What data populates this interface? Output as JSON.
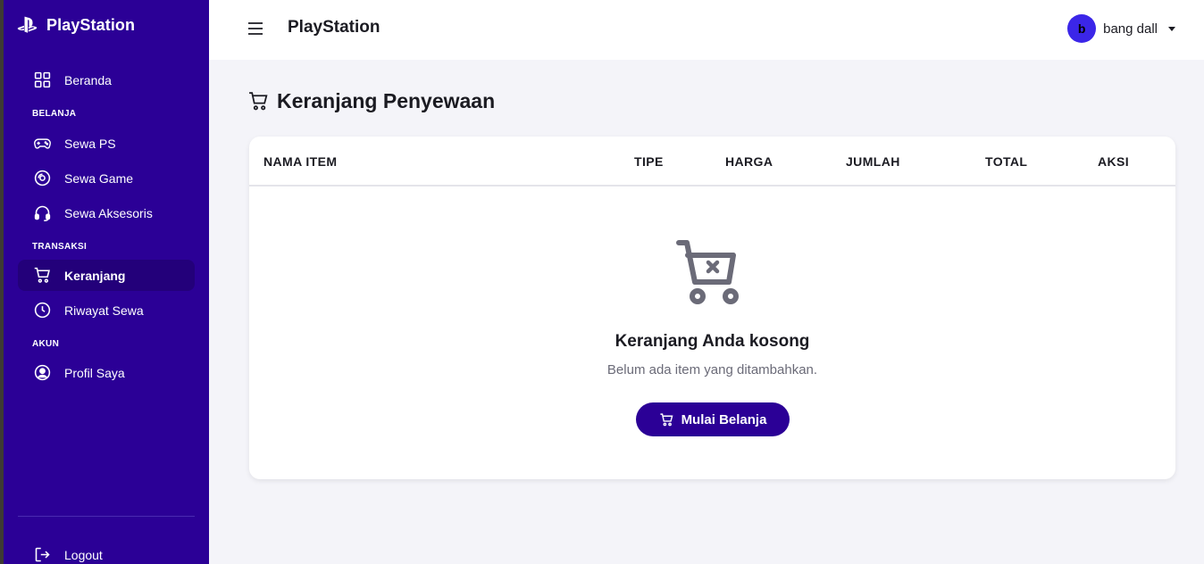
{
  "brand": {
    "name": "PlayStation",
    "icon": "playstation-logo-icon"
  },
  "sidebar": {
    "home": {
      "label": "Beranda",
      "icon": "grid-icon"
    },
    "section_shop": "BELANJA",
    "shop_items": [
      {
        "label": "Sewa PS",
        "icon": "gamepad-icon"
      },
      {
        "label": "Sewa Game",
        "icon": "disc-icon"
      },
      {
        "label": "Sewa Aksesoris",
        "icon": "headset-icon"
      }
    ],
    "section_transactions": "TRANSAKSI",
    "transaction_items": [
      {
        "label": "Keranjang",
        "icon": "cart-icon",
        "active": true
      },
      {
        "label": "Riwayat Sewa",
        "icon": "clock-icon"
      }
    ],
    "section_account": "AKUN",
    "account_items": [
      {
        "label": "Profil Saya",
        "icon": "user-circle-icon"
      }
    ],
    "logout": {
      "label": "Logout",
      "icon": "logout-icon"
    }
  },
  "topbar": {
    "title": "PlayStation",
    "user": {
      "initial": "b",
      "name": "bang dall"
    }
  },
  "main": {
    "heading": "Keranjang Penyewaan",
    "table": {
      "columns": [
        "NAMA ITEM",
        "TIPE",
        "HARGA",
        "JUMLAH",
        "TOTAL",
        "AKSI"
      ]
    },
    "empty": {
      "title": "Keranjang Anda kosong",
      "subtitle": "Belum ada item yang ditambahkan.",
      "button_label": "Mulai Belanja"
    }
  },
  "colors": {
    "sidebar_bg": "#2b0096",
    "active_item_bg": "#23007a",
    "avatar_bg": "#3b26e8",
    "page_bg": "#f4f4f9",
    "empty_icon": "#6b6b78"
  }
}
